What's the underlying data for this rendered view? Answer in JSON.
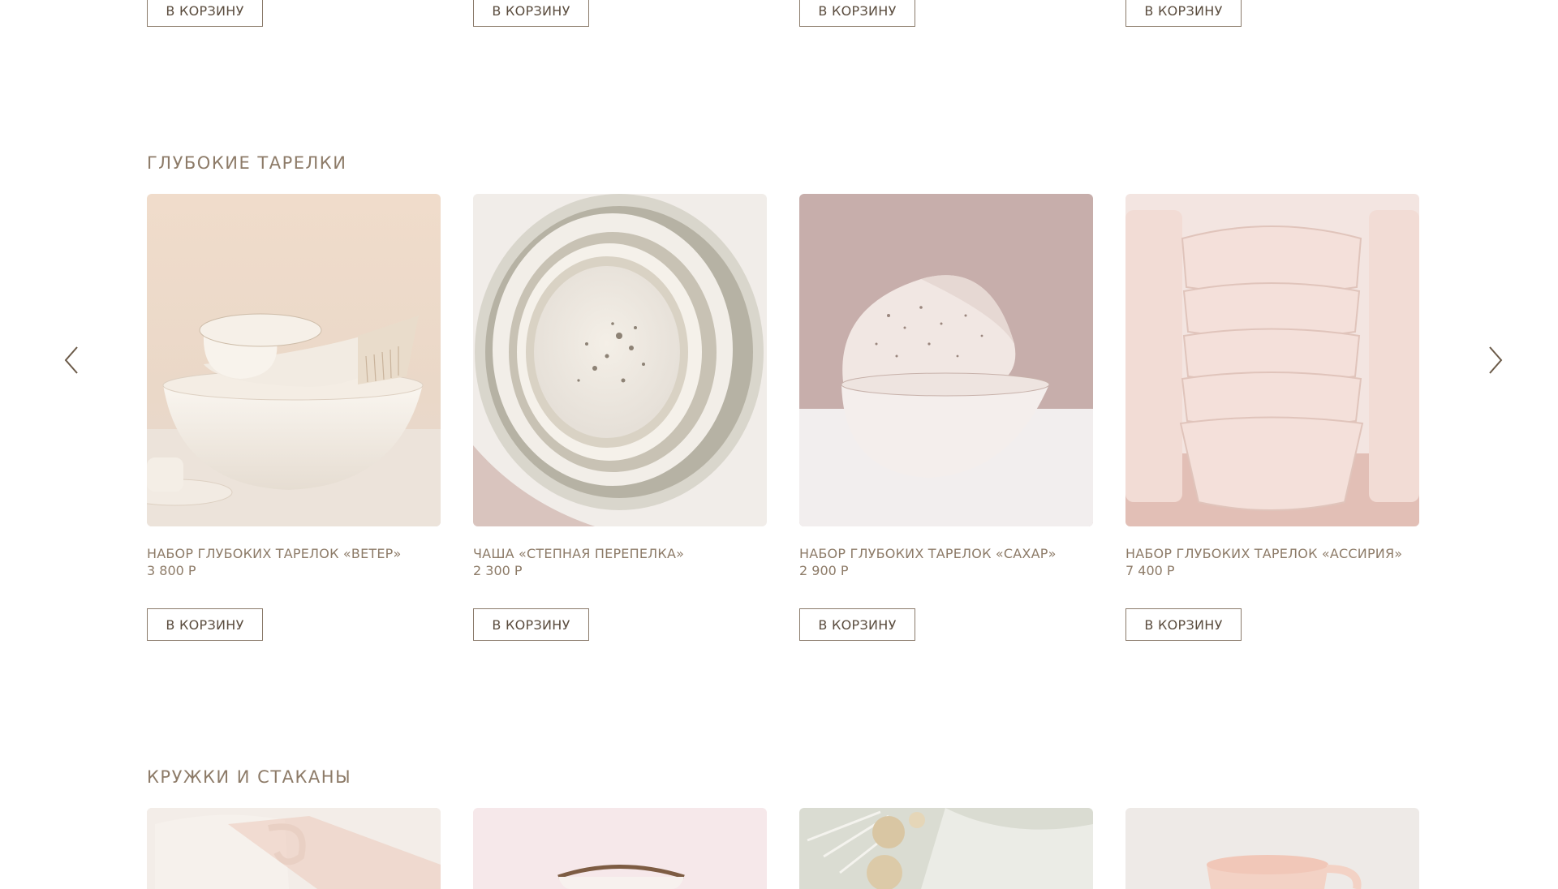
{
  "top_buttons": [
    "В КОРЗИНУ",
    "В КОРЗИНУ",
    "В КОРЗИНУ",
    "В КОРЗИНУ"
  ],
  "bowls_section": {
    "title": "ГЛУБОКИЕ ТАРЕЛКИ",
    "products": [
      {
        "name": "НАБОР ГЛУБОКИХ ТАРЕЛОК «ВЕТЕР»",
        "price": "3 800 Р",
        "button": "В КОРЗИНУ"
      },
      {
        "name": "ЧАША «СТЕПНАЯ ПЕРЕПЕЛКА»",
        "price": "2 300 Р",
        "button": "В КОРЗИНУ"
      },
      {
        "name": "НАБОР ГЛУБОКИХ ТАРЕЛОК «САХАР»",
        "price": "2 900 Р",
        "button": "В КОРЗИНУ"
      },
      {
        "name": "НАБОР ГЛУБОКИХ ТАРЕЛОК «АССИРИЯ»",
        "price": "7 400 Р",
        "button": "В КОРЗИНУ"
      }
    ],
    "prev_icon": "chevron-left-icon",
    "next_icon": "chevron-right-icon"
  },
  "mugs_section": {
    "title": "КРУЖКИ И СТАКАНЫ"
  },
  "colors": {
    "text": "#8d7b68",
    "button_border": "#8a7a6a",
    "background": "#ffffff"
  }
}
